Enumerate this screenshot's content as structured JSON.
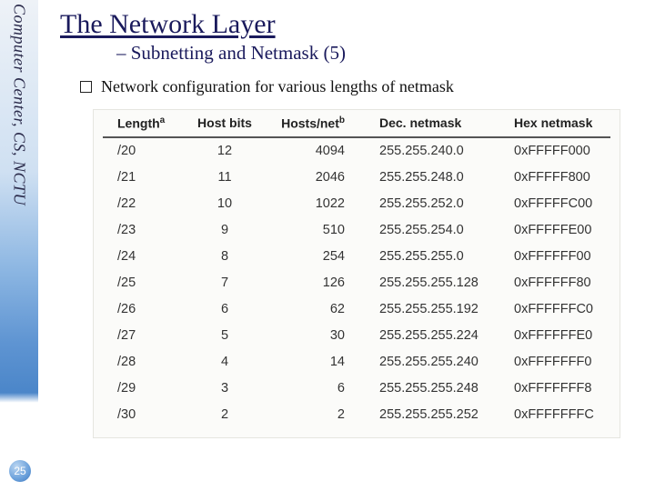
{
  "sidebar": {
    "org_text": "Computer Center, CS, NCTU"
  },
  "page_number": "25",
  "header": {
    "title": "The Network Layer",
    "subtitle": "– Subnetting and Netmask (5)"
  },
  "bullet": {
    "text": "Network configuration for various lengths of netmask"
  },
  "chart_data": {
    "type": "table",
    "title": "Network configuration for various lengths of netmask",
    "headers": {
      "length": "Length",
      "length_sup": "a",
      "host_bits": "Host bits",
      "hosts_per_net": "Hosts/net",
      "hosts_per_net_sup": "b",
      "dec_netmask": "Dec. netmask",
      "hex_netmask": "Hex netmask"
    },
    "rows": [
      {
        "length": "/20",
        "host_bits": "12",
        "hosts_per_net": "4094",
        "dec": "255.255.240.0",
        "hex": "0xFFFFF000"
      },
      {
        "length": "/21",
        "host_bits": "11",
        "hosts_per_net": "2046",
        "dec": "255.255.248.0",
        "hex": "0xFFFFF800"
      },
      {
        "length": "/22",
        "host_bits": "10",
        "hosts_per_net": "1022",
        "dec": "255.255.252.0",
        "hex": "0xFFFFFC00"
      },
      {
        "length": "/23",
        "host_bits": "9",
        "hosts_per_net": "510",
        "dec": "255.255.254.0",
        "hex": "0xFFFFFE00"
      },
      {
        "length": "/24",
        "host_bits": "8",
        "hosts_per_net": "254",
        "dec": "255.255.255.0",
        "hex": "0xFFFFFF00"
      },
      {
        "length": "/25",
        "host_bits": "7",
        "hosts_per_net": "126",
        "dec": "255.255.255.128",
        "hex": "0xFFFFFF80"
      },
      {
        "length": "/26",
        "host_bits": "6",
        "hosts_per_net": "62",
        "dec": "255.255.255.192",
        "hex": "0xFFFFFFC0"
      },
      {
        "length": "/27",
        "host_bits": "5",
        "hosts_per_net": "30",
        "dec": "255.255.255.224",
        "hex": "0xFFFFFFE0"
      },
      {
        "length": "/28",
        "host_bits": "4",
        "hosts_per_net": "14",
        "dec": "255.255.255.240",
        "hex": "0xFFFFFFF0"
      },
      {
        "length": "/29",
        "host_bits": "3",
        "hosts_per_net": "6",
        "dec": "255.255.255.248",
        "hex": "0xFFFFFFF8"
      },
      {
        "length": "/30",
        "host_bits": "2",
        "hosts_per_net": "2",
        "dec": "255.255.255.252",
        "hex": "0xFFFFFFFC"
      }
    ]
  }
}
